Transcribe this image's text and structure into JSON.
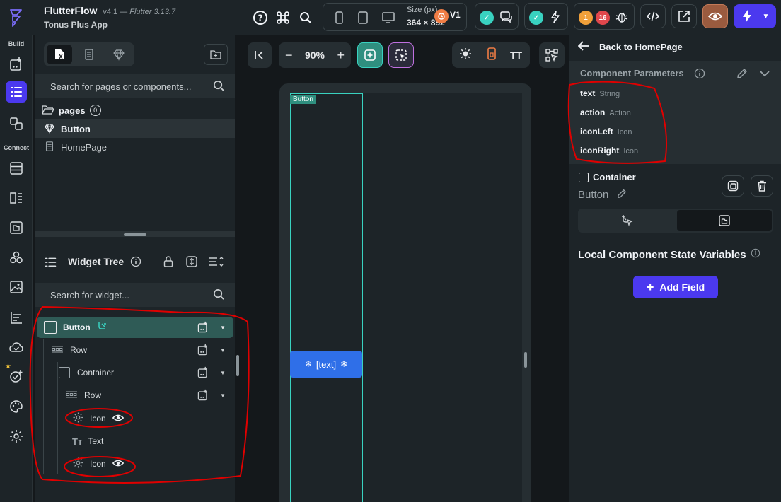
{
  "app": {
    "name": "FlutterFlow",
    "version": "v4.1",
    "flutter": "Flutter 3.13.7",
    "project": "Tonus Plus App"
  },
  "device": {
    "size_label": "Size (px)",
    "size_value": "364 × 852"
  },
  "badges": {
    "v1": "V1",
    "warnings": "1",
    "errors": "16"
  },
  "rail": {
    "build_label": "Build",
    "connect_label": "Connect"
  },
  "pages_panel": {
    "search_placeholder": "Search for pages or components...",
    "pages_label": "pages",
    "pages_count": "0",
    "items": [
      "Button",
      "HomePage"
    ]
  },
  "widget_tree": {
    "title": "Widget Tree",
    "search_placeholder": "Search for widget...",
    "nodes": [
      "Button",
      "Row",
      "Container",
      "Row",
      "Icon",
      "Text",
      "Icon"
    ]
  },
  "canvas": {
    "zoom": "90%",
    "component_tag": "Button",
    "button_text": "[text]"
  },
  "right_panel": {
    "back_label": "Back to HomePage",
    "params_title": "Component Parameters",
    "params": [
      {
        "name": "text",
        "type": "String"
      },
      {
        "name": "action",
        "type": "Action"
      },
      {
        "name": "iconLeft",
        "type": "Icon"
      },
      {
        "name": "iconRight",
        "type": "Icon"
      }
    ],
    "container_label": "Container",
    "container_name": "Button",
    "state_vars_title": "Local Component State Variables",
    "add_field_label": "Add Field"
  },
  "colors": {
    "primary": "#4b39ef",
    "accent_teal": "#39d2c0",
    "selected_row": "#2f5b56",
    "annotation_red": "#e00000",
    "preview_button": "#2f6fe8"
  }
}
